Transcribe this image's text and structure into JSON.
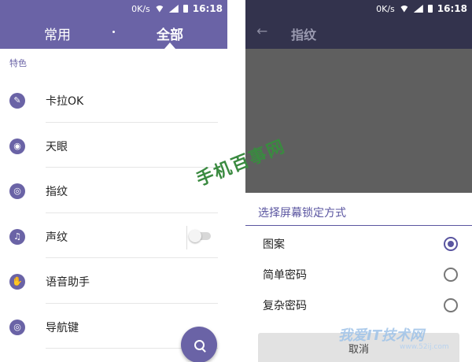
{
  "status_bar": {
    "speed": "0K/s",
    "time": "16:18"
  },
  "left": {
    "tabs": [
      "常用",
      "全部"
    ],
    "section": "特色",
    "items": [
      {
        "label": "卡拉OK",
        "icon": "pen-icon"
      },
      {
        "label": "天眼",
        "icon": "eye-icon"
      },
      {
        "label": "指纹",
        "icon": "fingerprint-icon"
      },
      {
        "label": "声纹",
        "icon": "voice-print-icon",
        "toggle": false
      },
      {
        "label": "语音助手",
        "icon": "hand-icon"
      },
      {
        "label": "导航键",
        "icon": "nav-key-icon"
      }
    ],
    "fab": "search-icon"
  },
  "right": {
    "title": "指纹",
    "dialog": {
      "title": "选择屏幕锁定方式",
      "options": [
        {
          "label": "图案",
          "selected": true
        },
        {
          "label": "简单密码",
          "selected": false
        },
        {
          "label": "复杂密码",
          "selected": false
        }
      ],
      "cancel": "取消"
    }
  },
  "watermarks": {
    "green": "手机百事网",
    "blue": "我爱IT技术网",
    "url": "www.52ij.com"
  },
  "colors": {
    "accent": "#6a63a6",
    "dark_header": "#33334d",
    "dim_overlay": "#5f5f5f"
  }
}
